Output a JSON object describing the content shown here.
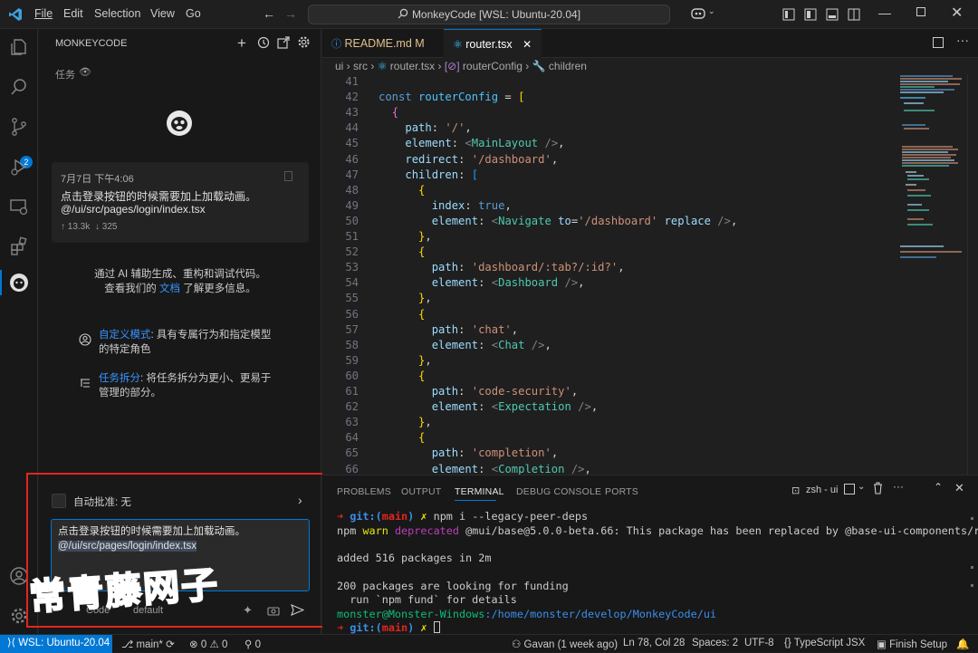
{
  "titlebar": {
    "menus": [
      "File",
      "Edit",
      "Selection",
      "View",
      "Go"
    ],
    "command_center": "MonkeyCode [WSL: Ubuntu-20.04]"
  },
  "activity": {
    "scm_badge": "2"
  },
  "sidebar": {
    "title": "MONKEYCODE",
    "tasks_label": "任务",
    "card": {
      "time": "7月7日 下午4:06",
      "text1": "点击登录按钮的时候需要加上加载动画。",
      "text2": "@/ui/src/pages/login/index.tsx",
      "stat_up": "↑ 13.3k",
      "stat_down": "↓ 325"
    },
    "intro1": "通过 AI 辅助生成、重构和调试代码。",
    "intro2a": "查看我们的",
    "intro2_link": "文档",
    "intro2b": "了解更多信息。",
    "feature1_title": "自定义模式",
    "feature1_rest": ": 具有专属行为和指定模型",
    "feature1_line2": "的特定角色",
    "feature2_title": "任务拆分",
    "feature2_rest": ": 将任务拆分为更小、更易于",
    "feature2_line2": "管理的部分。",
    "auto_approve_label": "自动批准:",
    "auto_approve_value": "无",
    "input_line1": "点击登录按钮的时候需要加上加载动画。",
    "input_line2": "@/ui/src/pages/login/index.tsx",
    "mode_label": "Code",
    "model_label": "default",
    "watermark": "常青藤网子"
  },
  "editor": {
    "tabs": [
      {
        "name": "README.md",
        "badge": "M"
      },
      {
        "name": "router.tsx"
      }
    ],
    "breadcrumb": [
      "ui",
      "src",
      "router.tsx",
      "routerConfig",
      "children"
    ]
  },
  "code": [
    {
      "n": "41",
      "segs": []
    },
    {
      "n": "42",
      "segs": [
        [
          "k",
          "const "
        ],
        [
          "v",
          "routerConfig"
        ],
        [
          "w",
          " = "
        ],
        [
          "b1",
          "["
        ]
      ]
    },
    {
      "n": "43",
      "segs": [
        [
          "w",
          "  "
        ],
        [
          "b2",
          "{"
        ]
      ]
    },
    {
      "n": "44",
      "segs": [
        [
          "w",
          "    "
        ],
        [
          "p",
          "path"
        ],
        [
          "w",
          ": "
        ],
        [
          "s",
          "'/'"
        ],
        [
          "w",
          ","
        ]
      ]
    },
    {
      "n": "45",
      "segs": [
        [
          "w",
          "    "
        ],
        [
          "p",
          "element"
        ],
        [
          "w",
          ": "
        ],
        [
          "pu",
          "<"
        ],
        [
          "t",
          "MainLayout"
        ],
        [
          "pu",
          " />"
        ],
        [
          "w",
          ","
        ]
      ]
    },
    {
      "n": "46",
      "segs": [
        [
          "w",
          "    "
        ],
        [
          "p",
          "redirect"
        ],
        [
          "w",
          ": "
        ],
        [
          "s",
          "'/dashboard'"
        ],
        [
          "w",
          ","
        ]
      ]
    },
    {
      "n": "47",
      "segs": [
        [
          "w",
          "    "
        ],
        [
          "p",
          "children"
        ],
        [
          "w",
          ": "
        ],
        [
          "b3",
          "["
        ]
      ]
    },
    {
      "n": "48",
      "segs": [
        [
          "w",
          "      "
        ],
        [
          "b1",
          "{"
        ]
      ]
    },
    {
      "n": "49",
      "segs": [
        [
          "w",
          "        "
        ],
        [
          "p",
          "index"
        ],
        [
          "w",
          ": "
        ],
        [
          "k",
          "true"
        ],
        [
          "w",
          ","
        ]
      ]
    },
    {
      "n": "50",
      "segs": [
        [
          "w",
          "        "
        ],
        [
          "p",
          "element"
        ],
        [
          "w",
          ": "
        ],
        [
          "pu",
          "<"
        ],
        [
          "t",
          "Navigate"
        ],
        [
          "w",
          " "
        ],
        [
          "p",
          "to"
        ],
        [
          "w",
          "="
        ],
        [
          "s",
          "'/dashboard'"
        ],
        [
          "w",
          " "
        ],
        [
          "p",
          "replace"
        ],
        [
          "pu",
          " />"
        ],
        [
          "w",
          ","
        ]
      ]
    },
    {
      "n": "51",
      "segs": [
        [
          "w",
          "      "
        ],
        [
          "b1",
          "}"
        ],
        [
          "w",
          ","
        ]
      ]
    },
    {
      "n": "52",
      "segs": [
        [
          "w",
          "      "
        ],
        [
          "b1",
          "{"
        ]
      ]
    },
    {
      "n": "53",
      "segs": [
        [
          "w",
          "        "
        ],
        [
          "p",
          "path"
        ],
        [
          "w",
          ": "
        ],
        [
          "s",
          "'dashboard/:tab?/:id?'"
        ],
        [
          "w",
          ","
        ]
      ]
    },
    {
      "n": "54",
      "segs": [
        [
          "w",
          "        "
        ],
        [
          "p",
          "element"
        ],
        [
          "w",
          ": "
        ],
        [
          "pu",
          "<"
        ],
        [
          "t",
          "Dashboard"
        ],
        [
          "pu",
          " />"
        ],
        [
          "w",
          ","
        ]
      ]
    },
    {
      "n": "55",
      "segs": [
        [
          "w",
          "      "
        ],
        [
          "b1",
          "}"
        ],
        [
          "w",
          ","
        ]
      ]
    },
    {
      "n": "56",
      "segs": [
        [
          "w",
          "      "
        ],
        [
          "b1",
          "{"
        ]
      ]
    },
    {
      "n": "57",
      "segs": [
        [
          "w",
          "        "
        ],
        [
          "p",
          "path"
        ],
        [
          "w",
          ": "
        ],
        [
          "s",
          "'chat'"
        ],
        [
          "w",
          ","
        ]
      ]
    },
    {
      "n": "58",
      "segs": [
        [
          "w",
          "        "
        ],
        [
          "p",
          "element"
        ],
        [
          "w",
          ": "
        ],
        [
          "pu",
          "<"
        ],
        [
          "t",
          "Chat"
        ],
        [
          "pu",
          " />"
        ],
        [
          "w",
          ","
        ]
      ]
    },
    {
      "n": "59",
      "segs": [
        [
          "w",
          "      "
        ],
        [
          "b1",
          "}"
        ],
        [
          "w",
          ","
        ]
      ]
    },
    {
      "n": "60",
      "segs": [
        [
          "w",
          "      "
        ],
        [
          "b1",
          "{"
        ]
      ]
    },
    {
      "n": "61",
      "segs": [
        [
          "w",
          "        "
        ],
        [
          "p",
          "path"
        ],
        [
          "w",
          ": "
        ],
        [
          "s",
          "'code-security'"
        ],
        [
          "w",
          ","
        ]
      ]
    },
    {
      "n": "62",
      "segs": [
        [
          "w",
          "        "
        ],
        [
          "p",
          "element"
        ],
        [
          "w",
          ": "
        ],
        [
          "pu",
          "<"
        ],
        [
          "t",
          "Expectation"
        ],
        [
          "pu",
          " />"
        ],
        [
          "w",
          ","
        ]
      ]
    },
    {
      "n": "63",
      "segs": [
        [
          "w",
          "      "
        ],
        [
          "b1",
          "}"
        ],
        [
          "w",
          ","
        ]
      ]
    },
    {
      "n": "64",
      "segs": [
        [
          "w",
          "      "
        ],
        [
          "b1",
          "{"
        ]
      ]
    },
    {
      "n": "65",
      "segs": [
        [
          "w",
          "        "
        ],
        [
          "p",
          "path"
        ],
        [
          "w",
          ": "
        ],
        [
          "s",
          "'completion'"
        ],
        [
          "w",
          ","
        ]
      ]
    },
    {
      "n": "66",
      "segs": [
        [
          "w",
          "        "
        ],
        [
          "p",
          "element"
        ],
        [
          "w",
          ": "
        ],
        [
          "pu",
          "<"
        ],
        [
          "t",
          "Completion"
        ],
        [
          "pu",
          " />"
        ],
        [
          "w",
          ","
        ]
      ]
    }
  ],
  "panel": {
    "tabs": [
      "PROBLEMS",
      "OUTPUT",
      "TERMINAL",
      "DEBUG CONSOLE",
      "PORTS"
    ],
    "active_tab": "TERMINAL",
    "shell_label": "zsh - ui"
  },
  "terminal": {
    "l1_git": "git:(",
    "l1_branch": "main",
    "l1_close": ")",
    "l1_cmd": "npm i --legacy-peer-deps",
    "l2_npm": "npm",
    "l2_warn": "warn",
    "l2_dep": "deprecated",
    "l2_rest": "@mui/base@5.0.0-beta.66: This package has been replaced by @base-ui-components/react",
    "l3": "added 516 packages in 2m",
    "l4": "200 packages are looking for funding",
    "l5": "  run `npm fund` for details",
    "l6_user": "monster@Monster-Windows",
    "l6_path": ":/home/monster/develop/MonkeyCode/ui"
  },
  "status": {
    "remote": "WSL: Ubuntu-20.04",
    "branch": "main*",
    "errors": "0",
    "warnings": "0",
    "ports": "0",
    "blame": "Gavan (1 week ago)",
    "position": "Ln 78, Col 28",
    "spaces": "Spaces: 2",
    "encoding": "UTF-8",
    "language": "TypeScript JSX",
    "finish": "Finish Setup"
  }
}
